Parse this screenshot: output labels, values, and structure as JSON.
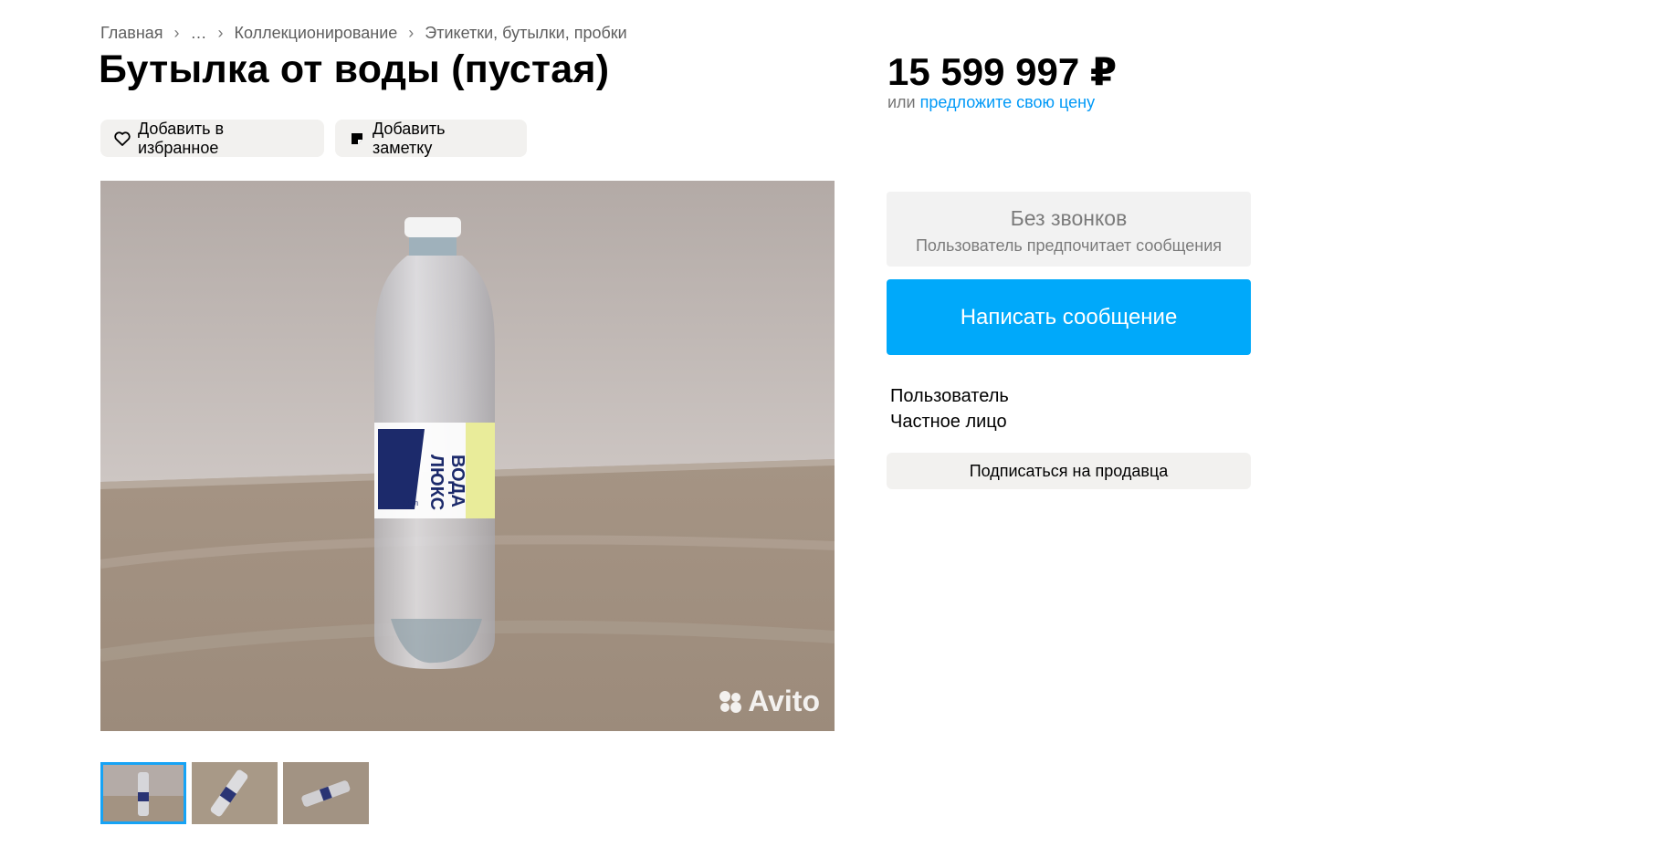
{
  "breadcrumb": {
    "items": [
      "Главная",
      "…",
      "Коллекционирование",
      "Этикетки, бутылки, пробки"
    ],
    "separator": "›"
  },
  "listing": {
    "title": "Бутылка от воды (пустая)",
    "add_favorite_label": "Добавить в избранное",
    "add_note_label": "Добавить заметку",
    "photo_watermark": "Avito",
    "label_brand_line1": "ЛЮКС",
    "label_brand_line2": "ВОДА",
    "label_volume": "0,5 л"
  },
  "price": {
    "amount": "15 599 997 ₽",
    "offer_prefix": "или",
    "offer_link": "предложите свою цену"
  },
  "contact": {
    "no_calls_title": "Без звонков",
    "no_calls_subtitle": "Пользователь предпочитает сообщения",
    "message_button": "Написать сообщение"
  },
  "seller": {
    "name": "Пользователь",
    "type": "Частное лицо",
    "subscribe_button": "Подписаться на продавца"
  },
  "colors": {
    "accent_blue": "#00a9fa",
    "link_blue": "#0099f7",
    "thumb_active": "#16a3f5"
  },
  "icons": {
    "favorite": "heart-icon",
    "note": "note-icon",
    "watermark": "avito-logo-icon"
  }
}
